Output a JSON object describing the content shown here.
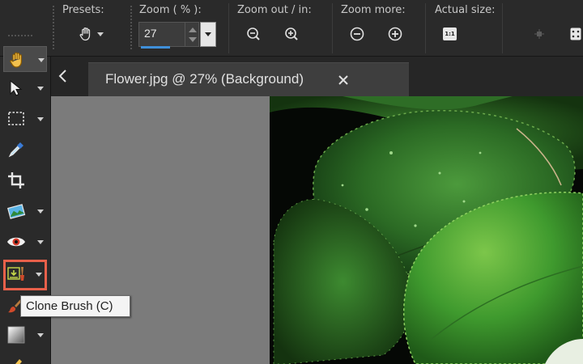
{
  "options_bar": {
    "presets_label": "Presets:",
    "zoom_label": "Zoom ( % ):",
    "zoom_value": "27",
    "zoom_out_in_label": "Zoom out / in:",
    "zoom_more_label": "Zoom more:",
    "actual_size_label": "Actual size:",
    "actual_size_icon_text": "1:1"
  },
  "tools": [
    {
      "name": "pan-tool",
      "icon": "hand-icon",
      "selected": true
    },
    {
      "name": "pick-tool",
      "icon": "arrow-pointer-icon"
    },
    {
      "name": "selection-tool",
      "icon": "marquee-icon"
    },
    {
      "name": "dropper-tool",
      "icon": "eyedropper-icon"
    },
    {
      "name": "crop-tool",
      "icon": "crop-icon"
    },
    {
      "name": "straighten-tool",
      "icon": "picture-icon"
    },
    {
      "name": "red-eye-tool",
      "icon": "eye-icon"
    },
    {
      "name": "clone-brush-tool",
      "icon": "clone-brush-icon",
      "highlighted": true
    },
    {
      "name": "paint-brush-tool",
      "icon": "brush-icon"
    },
    {
      "name": "gradient-tool",
      "icon": "gradient-icon"
    }
  ],
  "document_tab": {
    "title": "Flower.jpg @  27% (Background)"
  },
  "tooltip": {
    "text": "Clone Brush (C)"
  },
  "colors": {
    "accent_blue": "#3f8fd9",
    "highlight_orange": "#e8604a",
    "panel_bg": "#2a2a2a",
    "workspace_gray": "#7b7b7b"
  }
}
